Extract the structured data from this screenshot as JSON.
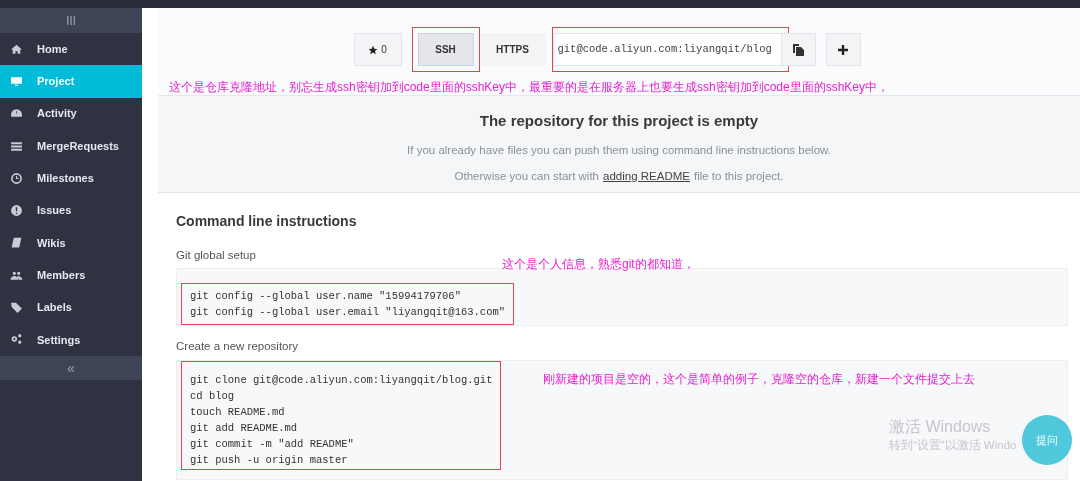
{
  "sidebar": {
    "collapse": "«",
    "items": [
      {
        "label": "Home",
        "selected": false
      },
      {
        "label": "Project",
        "selected": true
      },
      {
        "label": "Activity",
        "selected": false
      },
      {
        "label": "MergeRequests",
        "selected": false
      },
      {
        "label": "Milestones",
        "selected": false
      },
      {
        "label": "Issues",
        "selected": false
      },
      {
        "label": "Wikis",
        "selected": false
      },
      {
        "label": "Members",
        "selected": false
      },
      {
        "label": "Labels",
        "selected": false
      },
      {
        "label": "Settings",
        "selected": false
      }
    ]
  },
  "clone_bar": {
    "star_count": "0",
    "protocols": [
      {
        "label": "SSH",
        "selected": true
      },
      {
        "label": "HTTPS",
        "selected": false
      }
    ],
    "url": "git@code.aliyun.com:liyangqit/blog",
    "note": "这个是仓库克隆地址，别忘生成ssh密钥加到code里面的sshKey中，最重要的是在服务器上也要生成ssh密钥加到code里面的sshKey中，"
  },
  "empty_state": {
    "title": "The repository for this project is empty",
    "line": "If you already have files you can push them using command line instructions below.",
    "prefix": "Otherwise you can start with",
    "link": "adding README",
    "suffix": "file to this project."
  },
  "instructions": {
    "title": "Command line instructions",
    "sections": [
      {
        "heading": "Git global setup",
        "note": "这个是个人信息，熟悉git的都知道，",
        "lines": [
          "git config --global user.name \"15994179706\"",
          "git config --global user.email \"liyangqit@163.com\""
        ]
      },
      {
        "heading": "Create a new repository",
        "note": "刚新建的项目是空的，这个是简单的例子，克隆空的仓库，新建一个文件提交上去",
        "lines": [
          "git clone git@code.aliyun.com:liyangqit/blog.git",
          "cd blog",
          "touch README.md",
          "git add README.md",
          "git commit -m \"add README\"",
          "git push -u origin master"
        ]
      }
    ]
  },
  "activation": {
    "title": "激活 Windows",
    "hint": "转到“设置”以激活 Windo"
  },
  "help_button": "提问"
}
